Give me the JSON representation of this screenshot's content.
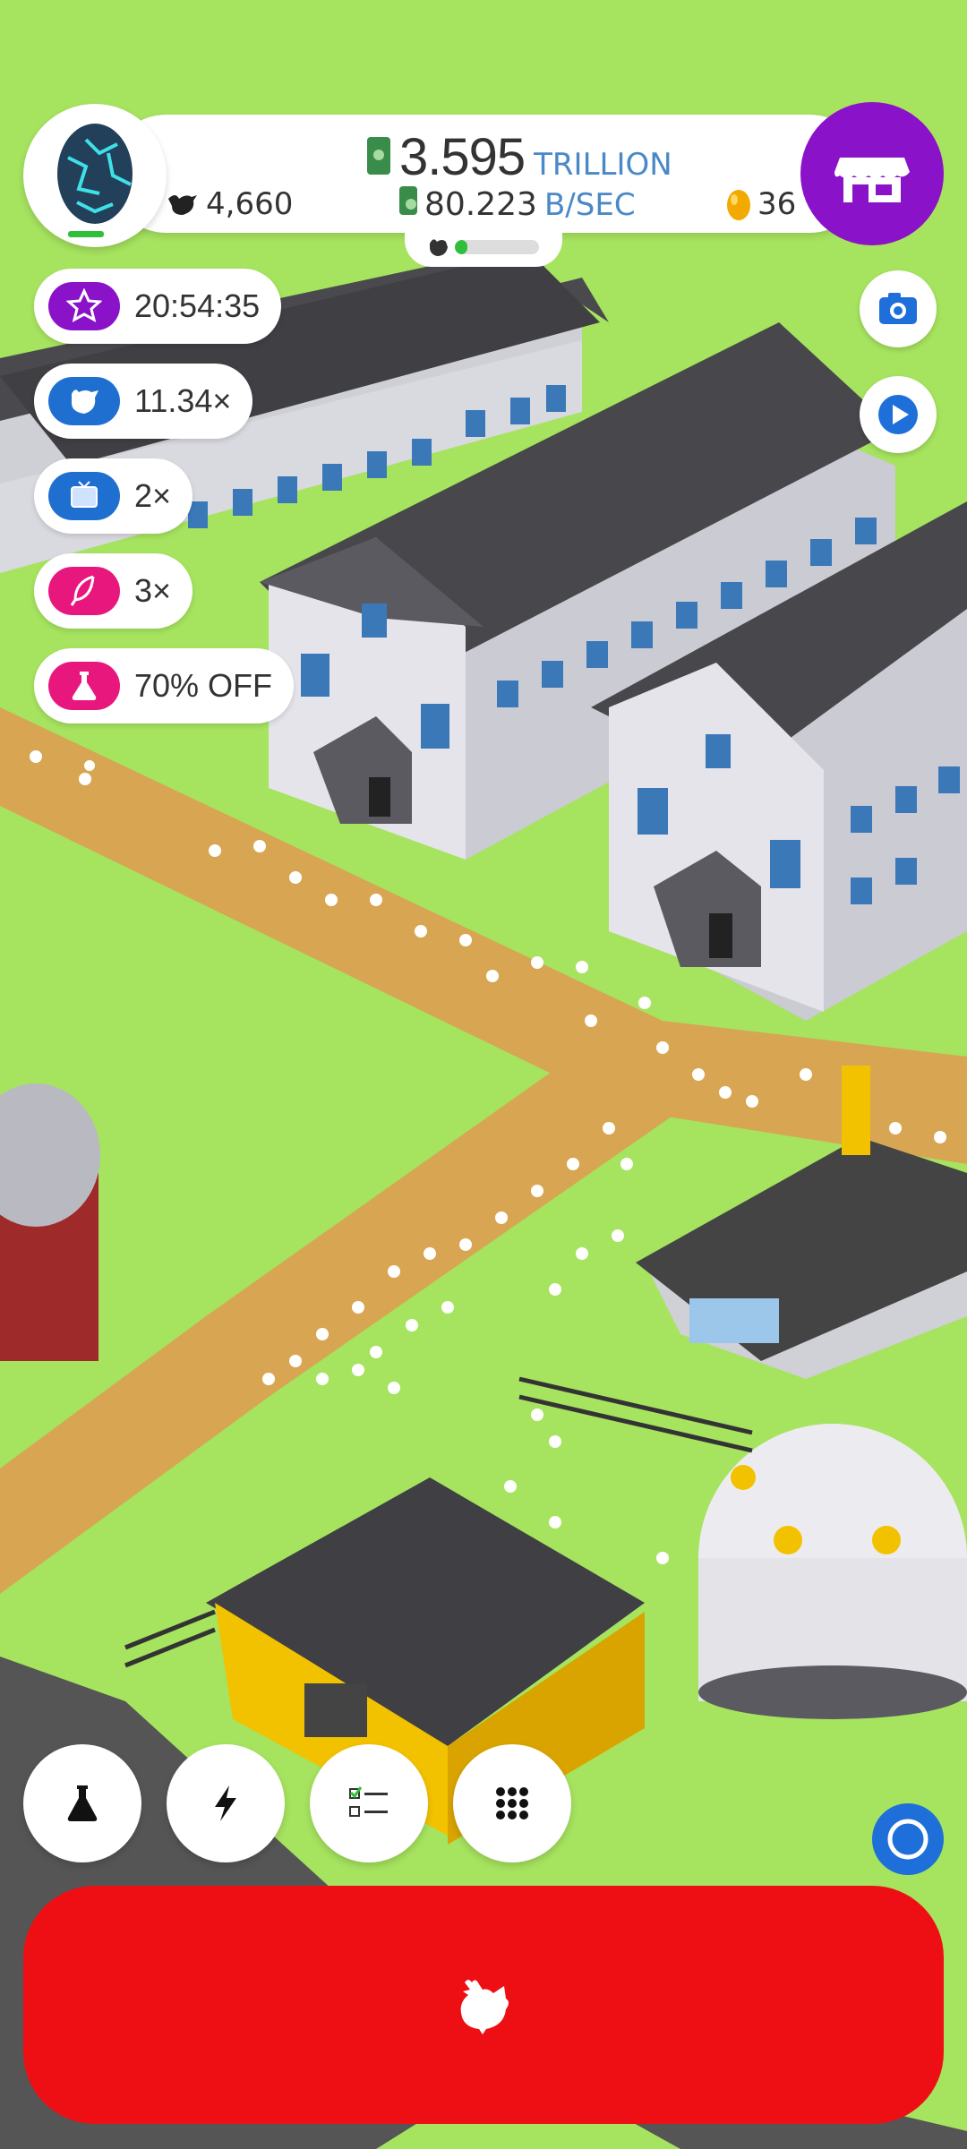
{
  "hud": {
    "money_value": "3.595",
    "money_unit": "TRILLION",
    "rate_value": "80.223",
    "rate_unit": "B/SEC",
    "chicken_count": "4,660",
    "egg_count": "36",
    "hatchery_progress": 0.15
  },
  "boosts": [
    {
      "icon": "star-icon",
      "label": "20:54:35",
      "color": "#8a12c8"
    },
    {
      "icon": "chicken-icon",
      "label": "11.34×",
      "color": "#1f6fd1"
    },
    {
      "icon": "tv-icon",
      "label": "2×",
      "color": "#1f6fd1"
    },
    {
      "icon": "feather-icon",
      "label": "3×",
      "color": "#e8177e"
    },
    {
      "icon": "flask-icon",
      "label": "70% OFF",
      "color": "#e8177e"
    }
  ],
  "side_buttons": {
    "camera": "camera-icon",
    "play": "play-icon"
  },
  "bottom_buttons": [
    {
      "name": "research",
      "icon": "flask-icon"
    },
    {
      "name": "boosts",
      "icon": "lightning-icon"
    },
    {
      "name": "missions",
      "icon": "checklist-icon"
    },
    {
      "name": "menu",
      "icon": "grid-icon"
    }
  ],
  "colors": {
    "grass": "#a6e35f",
    "road": "#d8a552",
    "shop": "#8a12c8",
    "hatch": "#ee0f14"
  }
}
